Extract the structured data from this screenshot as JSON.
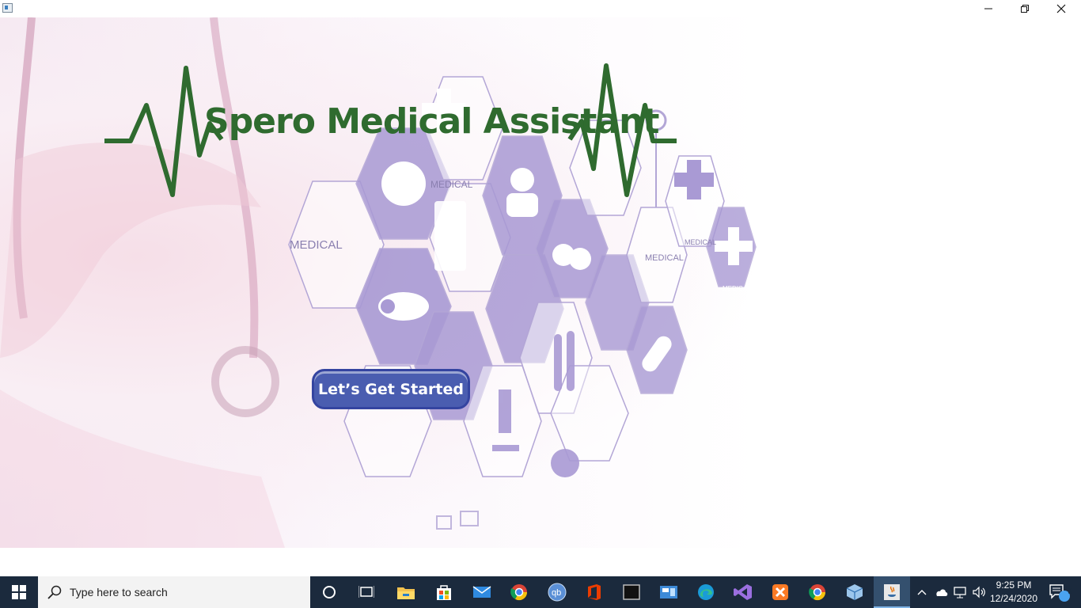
{
  "window": {
    "title_icon": "app-window-icon",
    "controls": [
      "minimize-icon",
      "restore-icon",
      "close-icon"
    ]
  },
  "app": {
    "logo_text": "Spero Medical Assistant",
    "start_button_label": "Let’s Get Started",
    "background_labels": [
      "MEDICAL",
      "MEDICAL",
      "MEDICAL",
      "MEDICAL",
      "MEDICAL"
    ],
    "colors": {
      "logo_green": "#2f6b2f",
      "button_blue": "#4a5db0",
      "hex_purple": "#a99ad4"
    }
  },
  "taskbar": {
    "search_placeholder": "Type here to search",
    "pinned": [
      "cortana-icon",
      "task-view-icon",
      "file-explorer-icon",
      "store-icon",
      "mail-icon",
      "chrome-icon",
      "qbittorrent-icon",
      "office-icon",
      "terminal-icon",
      "control-panel-icon",
      "edge-icon",
      "visual-studio-icon",
      "xampp-icon",
      "chrome-icon",
      "virtualbox-icon",
      "java-icon"
    ],
    "time": "9:25 PM",
    "date": "12/24/2020",
    "notification_count": "9"
  }
}
